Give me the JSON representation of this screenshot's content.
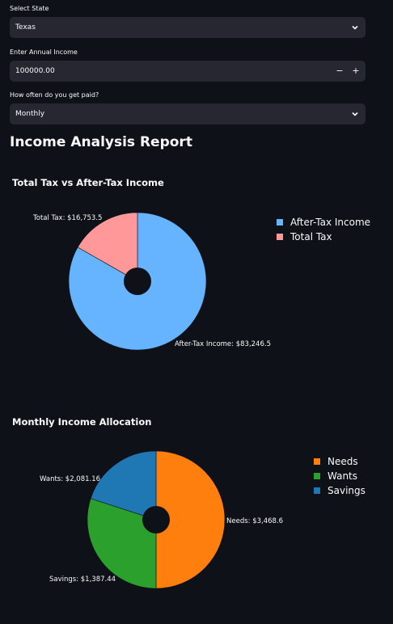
{
  "form": {
    "state_label": "Select State",
    "state_value": "Texas",
    "income_label": "Enter Annual Income",
    "income_value": "100000.00",
    "minus_label": "−",
    "plus_label": "+",
    "pay_label": "How often do you get paid?",
    "pay_value": "Monthly"
  },
  "report": {
    "title": "Income Analysis Report"
  },
  "chart_data": [
    {
      "type": "pie",
      "title": "Total Tax vs After-Tax Income",
      "labels": [
        "After-Tax Income",
        "Total Tax"
      ],
      "values": [
        83246.5,
        16753.5
      ],
      "slice_labels": [
        "After-Tax Income: $83,246.5",
        "Total Tax: $16,753.5"
      ],
      "colors": [
        "#66b3ff",
        "#ff9999"
      ],
      "legend": "right"
    },
    {
      "type": "pie",
      "title": "Monthly Income Allocation",
      "labels": [
        "Needs",
        "Wants",
        "Savings"
      ],
      "values": [
        3468.6,
        2081.16,
        1387.44
      ],
      "slice_labels": [
        "Needs: $3,468.6",
        "Wants: $2,081.16",
        "Savings: $1,387.44"
      ],
      "colors": [
        "#ff7f0e",
        "#2ca02c",
        "#1f77b4"
      ],
      "legend": "right"
    }
  ]
}
